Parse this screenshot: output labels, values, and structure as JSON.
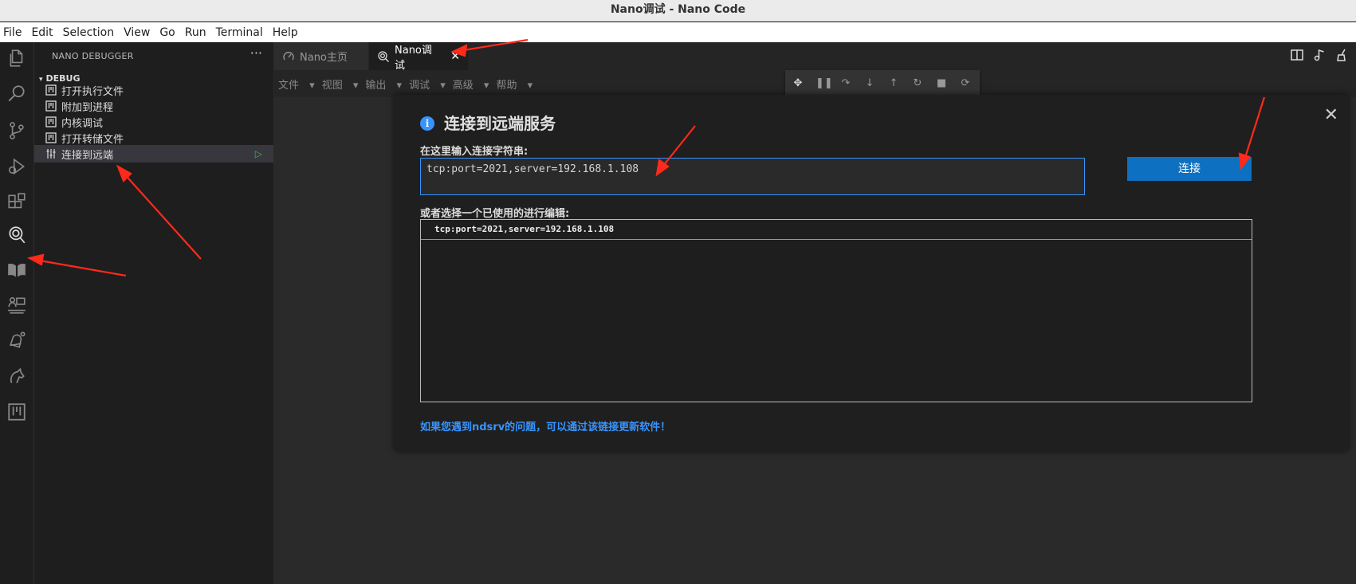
{
  "window": {
    "title": "Nano调试 - Nano Code"
  },
  "menubar": [
    "File",
    "Edit",
    "Selection",
    "View",
    "Go",
    "Run",
    "Terminal",
    "Help"
  ],
  "activity_bar": [
    "explorer-icon",
    "search-icon",
    "source-control-icon",
    "run-debug-icon",
    "extensions-icon",
    "nano-debugger-icon",
    "book-icon",
    "remote-icon",
    "bell-icon",
    "horse-icon",
    "board-icon"
  ],
  "sidebar": {
    "title": "NANO DEBUGGER",
    "more": "···",
    "section": "DEBUG",
    "items": [
      {
        "label": "打开执行文件"
      },
      {
        "label": "附加到进程"
      },
      {
        "label": "内核调试"
      },
      {
        "label": "打开转储文件"
      },
      {
        "label": "连接到远端"
      }
    ]
  },
  "tabs": [
    {
      "label": "Nano主页"
    },
    {
      "label": "Nano调试"
    }
  ],
  "editor_menu": [
    "文件",
    "视图",
    "输出",
    "调试",
    "高级",
    "帮助"
  ],
  "dialog": {
    "title": "连接到远端服务",
    "input_label": "在这里输入连接字符串:",
    "input_value": "tcp:port=2021,server=192.168.1.108",
    "connect_button": "连接",
    "history_label": "或者选择一个已使用的进行编辑:",
    "history": [
      "tcp:port=2021,server=192.168.1.108"
    ],
    "link": "如果您遇到ndsrv的问题，可以通过该链接更新软件！"
  },
  "colors": {
    "accent": "#0e70c0",
    "link": "#3794ff",
    "arrow": "#ff2a1a"
  }
}
